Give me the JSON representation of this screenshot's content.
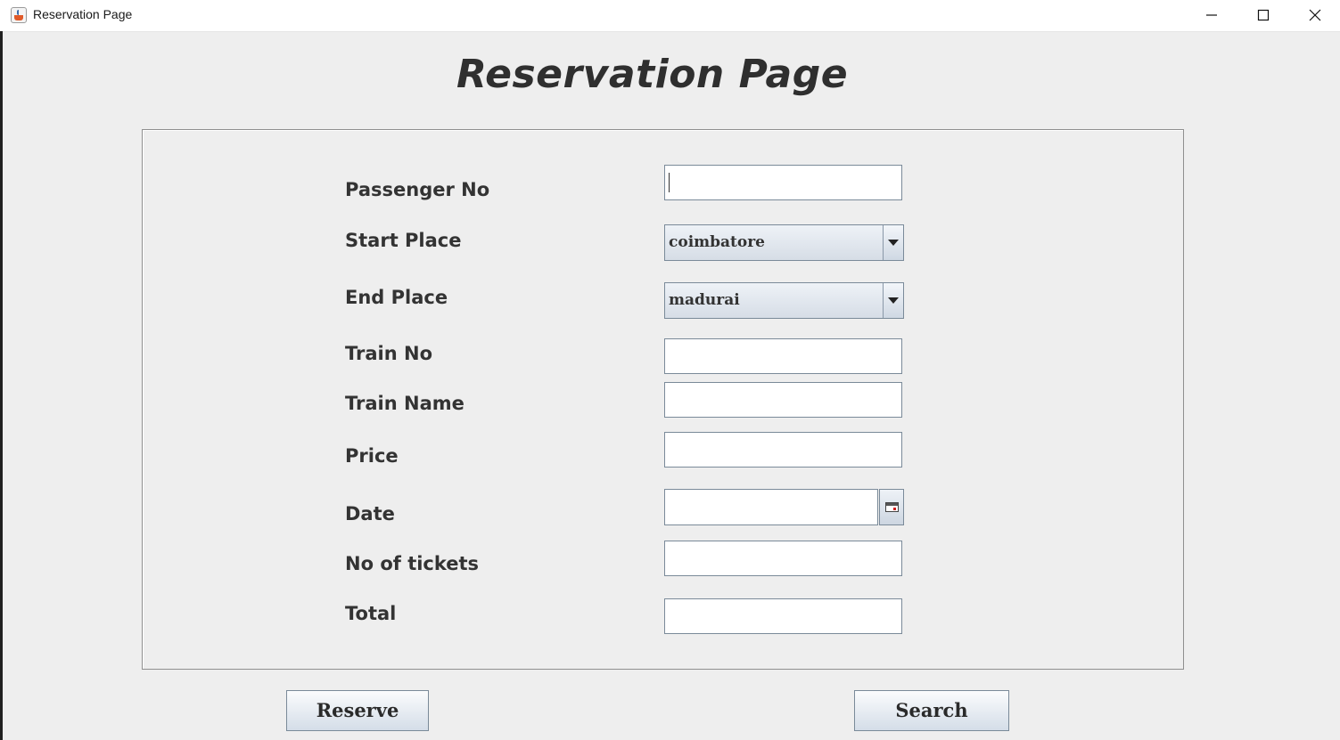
{
  "window": {
    "title": "Reservation Page"
  },
  "page": {
    "heading": "Reservation Page"
  },
  "form": {
    "passenger_no_label": "Passenger No",
    "passenger_no_value": "",
    "start_place_label": "Start Place",
    "start_place_value": "coimbatore",
    "end_place_label": "End Place",
    "end_place_value": "madurai",
    "train_no_label": "Train No",
    "train_no_value": "",
    "train_name_label": "Train Name",
    "train_name_value": "",
    "price_label": "Price",
    "price_value": "",
    "date_label": "Date",
    "date_value": "",
    "tickets_label": "No of tickets",
    "tickets_value": "",
    "total_label": "Total",
    "total_value": ""
  },
  "actions": {
    "reserve_label": "Reserve",
    "search_label": "Search"
  },
  "icons": {
    "app": "java-icon",
    "minimize": "minimize-icon",
    "maximize": "maximize-icon",
    "close": "close-icon",
    "calendar": "calendar-icon",
    "dropdown": "chevron-down-icon"
  }
}
